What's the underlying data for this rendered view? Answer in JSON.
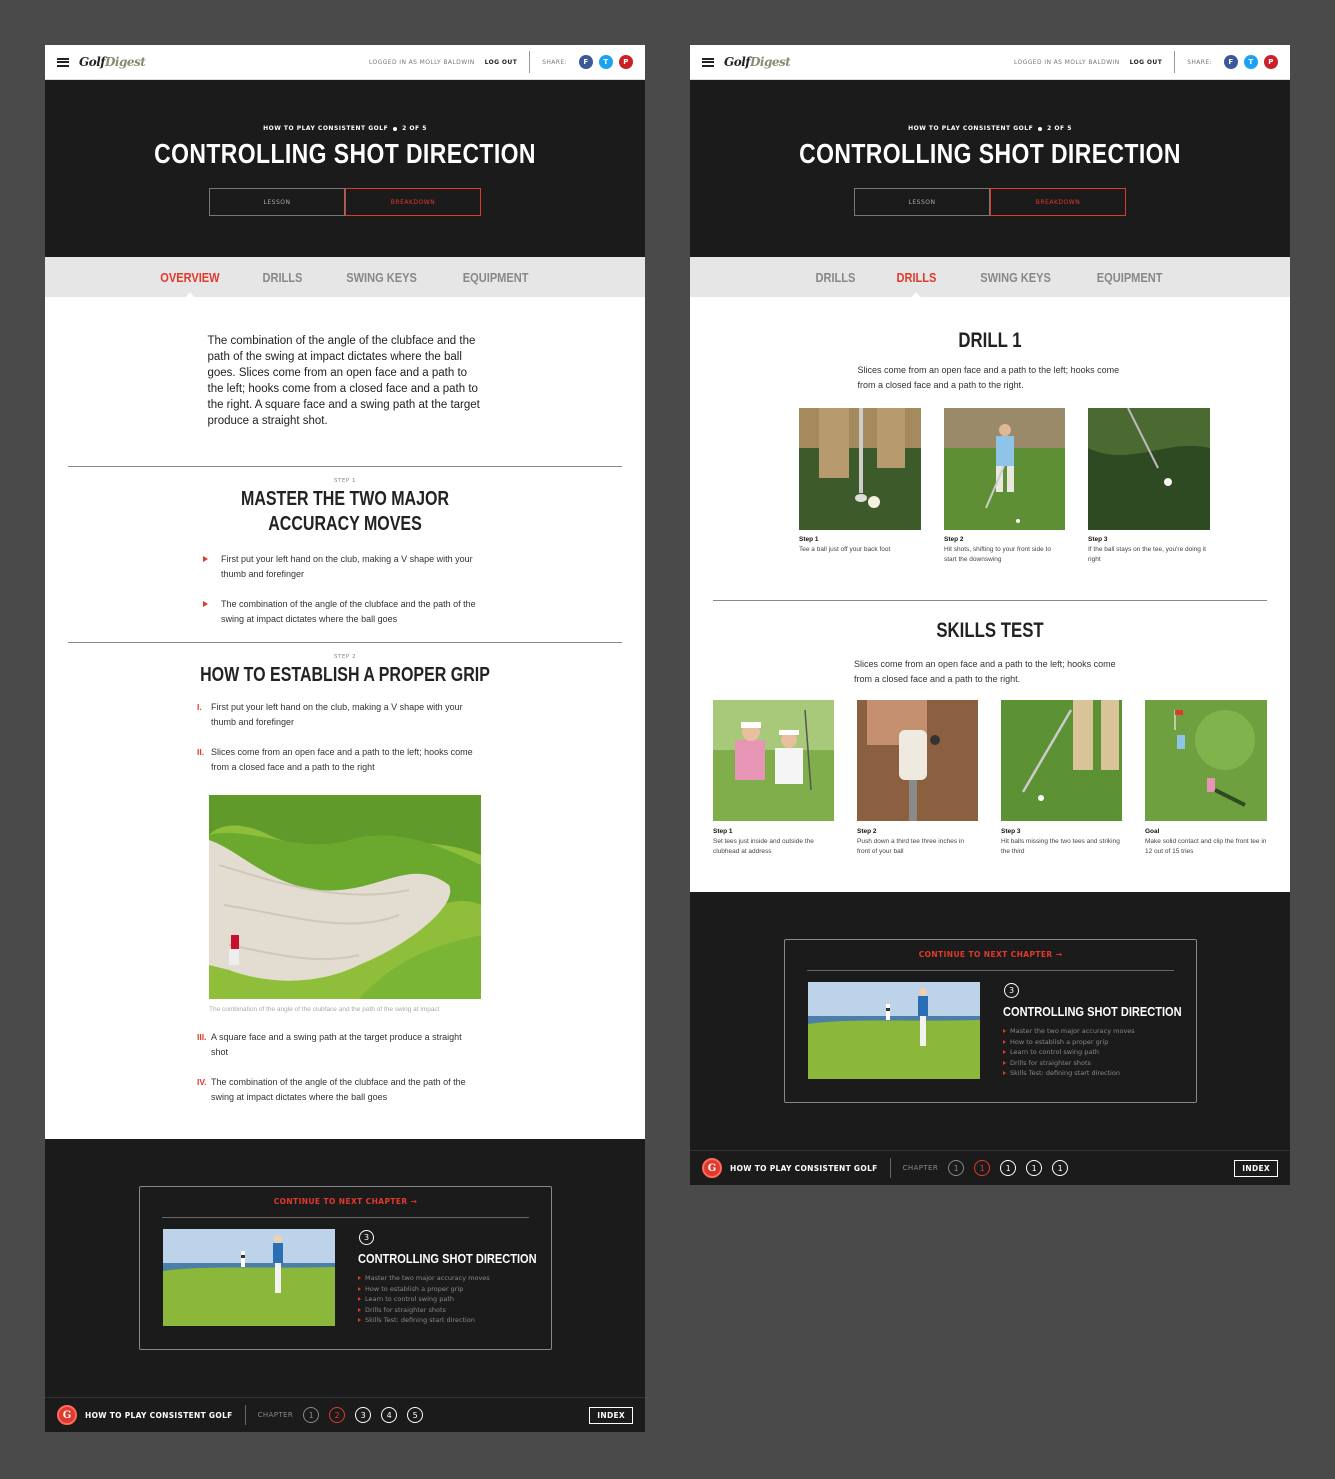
{
  "brand": {
    "logo_a": "Golf",
    "logo_b": "Digest"
  },
  "topbar": {
    "user_text": "LOGGED IN AS MOLLY BALDWIN",
    "logout": "LOG OUT",
    "share": "SHARE:",
    "fb": "f",
    "tw": "t",
    "pin": "p"
  },
  "colors": {
    "accent": "#e03a2e",
    "dark": "#1b1b1b",
    "facebook": "#3b5998",
    "twitter": "#1da1f2",
    "pinterest": "#cb2027"
  },
  "hero": {
    "kicker_course": "HOW TO PLAY CONSISTENT GOLF",
    "kicker_progress": "2 OF 5",
    "title": "CONTROLLING SHOT DIRECTION",
    "toggle_lesson": "LESSON",
    "toggle_breakdown": "BREAKDOWN"
  },
  "overview_page": {
    "tabs": [
      "OVERVIEW",
      "DRILLS",
      "SWING KEYS",
      "EQUIPMENT"
    ],
    "intro": "The combination of the angle of the clubface and the path of the swing at impact dictates where the ball goes. Slices come from an open face and a path to the left; hooks come from a closed face and a path to the right. A square face and a swing path at the target produce a straight shot.",
    "step1": {
      "kicker": "STEP 1",
      "title": "MASTER THE TWO MAJOR ACCURACY MOVES",
      "bullets": [
        "First put your left hand on the club, making a V shape with your thumb and forefinger",
        "The combination of the angle of the clubface and the path of the swing at impact dictates where the ball goes"
      ]
    },
    "step2": {
      "kicker": "STEP 2",
      "title": "HOW TO ESTABLISH A PROPER GRIP",
      "items": [
        {
          "num": "I.",
          "text": "First put your left hand on the club, making a V shape with your thumb and forefinger"
        },
        {
          "num": "II.",
          "text": "Slices come from an open face and a path to the left; hooks come from a closed face and a path to the right"
        }
      ],
      "caption": "The combination of the angle of the clubface and the path of the swing at impact",
      "items2": [
        {
          "num": "III.",
          "text": "A square face and a swing path at the target produce a straight shot"
        },
        {
          "num": "IV.",
          "text": "The combination of the angle of the clubface and the path of the swing at impact dictates where the ball goes"
        }
      ]
    }
  },
  "drills_page": {
    "tabs": [
      "DRILLS",
      "DRILLS",
      "SWING KEYS",
      "EQUIPMENT"
    ],
    "drill1": {
      "title": "DRILL 1",
      "text": "Slices come from an open face and a path to the left; hooks come from a closed face and a path to the right.",
      "steps": [
        {
          "label": "Step 1",
          "text": "Tee a ball just off your back foot"
        },
        {
          "label": "Step 2",
          "text": "Hit shots, shifting to your front side to start the downswing"
        },
        {
          "label": "Step 3",
          "text": "If the ball stays on the tee, you're doing it right"
        }
      ]
    },
    "skills": {
      "title": "SKILLS TEST",
      "text": "Slices come from an open face and a path to the left; hooks come from a closed face and a path to the right.",
      "steps": [
        {
          "label": "Step 1",
          "text": "Set tees just inside and outside the clubhead at address"
        },
        {
          "label": "Step 2",
          "text": "Push down a third tee three inches in front of your ball"
        },
        {
          "label": "Step 3",
          "text": "Hit balls missing the two tees and striking the third"
        },
        {
          "label": "Goal",
          "text": "Make solid contact and clip the front tee in 12 out of 15 tries"
        }
      ]
    }
  },
  "next_chapter": {
    "label": "CONTINUE TO NEXT CHAPTER →",
    "number": "3",
    "title": "CONTROLLING SHOT DIRECTION",
    "items": [
      "Master the two major accuracy moves",
      "How to establish a proper grip",
      "Learn to control swing path",
      "Drills for straighter shots",
      "Skills Test: defining start direction"
    ]
  },
  "bottom_bar": {
    "badge": "G",
    "course": "HOW TO PLAY CONSISTENT GOLF",
    "chapter_label": "CHAPTER",
    "chapters_a": [
      "1",
      "2",
      "3",
      "4",
      "5"
    ],
    "chapters_b": [
      "1",
      "1",
      "1",
      "1",
      "1"
    ],
    "index": "INDEX"
  }
}
